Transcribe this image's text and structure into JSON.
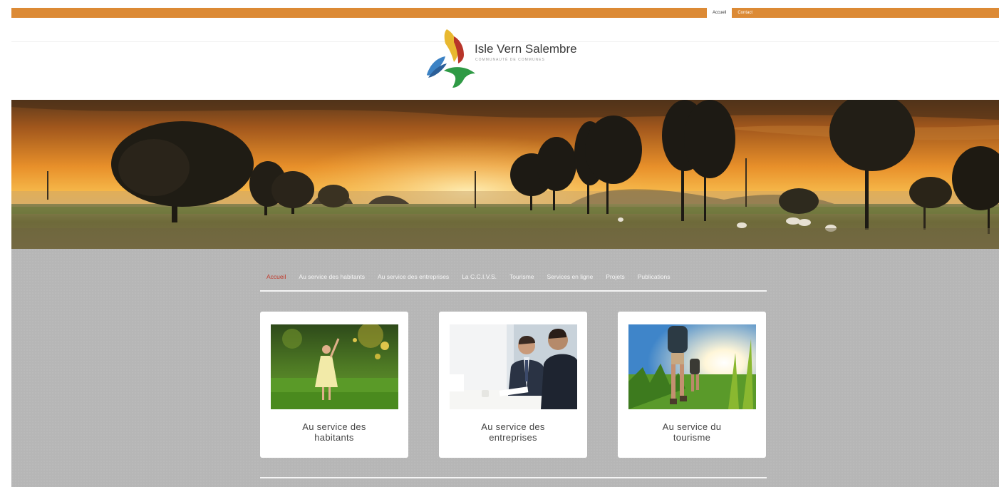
{
  "topnav": {
    "items": [
      {
        "label": "Accueil",
        "active": true
      },
      {
        "label": "Contact",
        "active": false
      }
    ],
    "bar_color": "#dc8a35"
  },
  "logo": {
    "name": "Isle Vern Salembre",
    "subtitle": "COMMUNAUTÉ DE COMMUNES",
    "colors": [
      "#e8b830",
      "#b8352a",
      "#3c82c4",
      "#2f9a45"
    ]
  },
  "hero": {
    "icon": "sunset-landscape-image"
  },
  "menu": {
    "items": [
      {
        "label": "Accueil",
        "active": true
      },
      {
        "label": "Au service des habitants",
        "active": false
      },
      {
        "label": "Au service des entreprises",
        "active": false
      },
      {
        "label": "La C.C.I.V.S.",
        "active": false
      },
      {
        "label": "Tourisme",
        "active": false
      },
      {
        "label": "Services en ligne",
        "active": false
      },
      {
        "label": "Projets",
        "active": false
      },
      {
        "label": "Publications",
        "active": false
      }
    ],
    "active_color": "#c0392b"
  },
  "cards": [
    {
      "line1": "Au service des",
      "line2": "habitants",
      "image": "child-in-garden-image"
    },
    {
      "line1": "Au service des",
      "line2": "entreprises",
      "image": "business-meeting-image"
    },
    {
      "line1": "Au service du",
      "line2": "tourisme",
      "image": "hikers-image"
    }
  ]
}
